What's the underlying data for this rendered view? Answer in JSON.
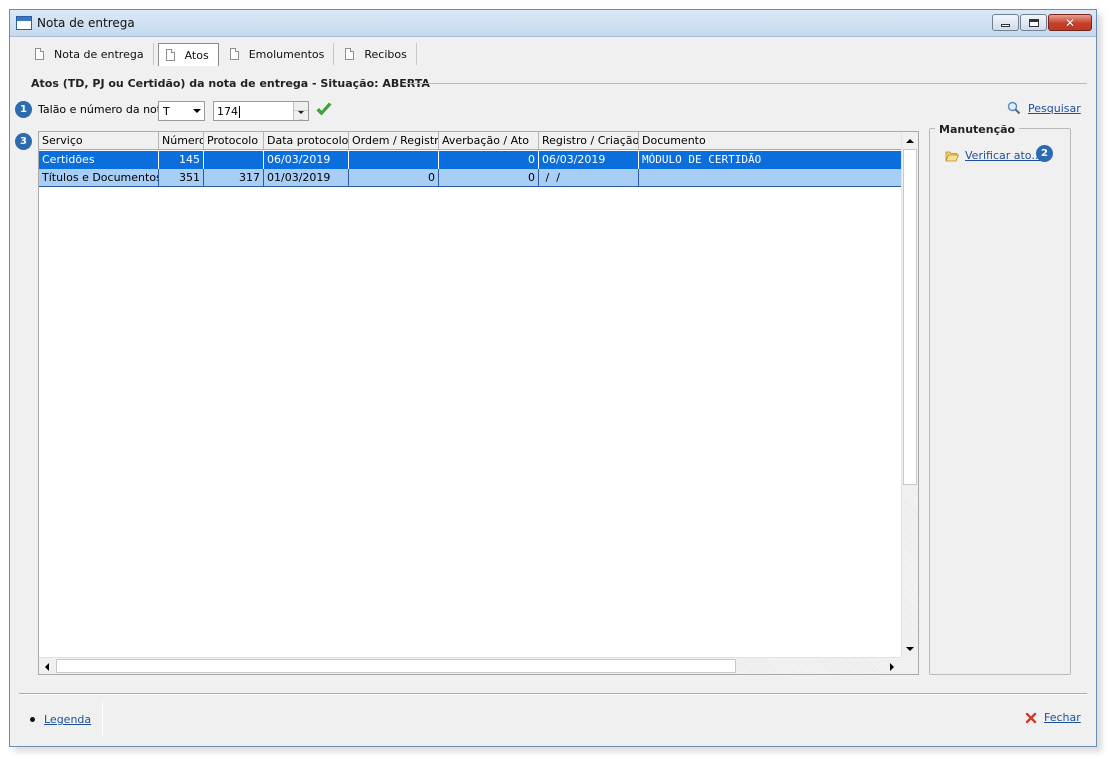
{
  "window": {
    "title": "Nota de entrega"
  },
  "tabs": [
    {
      "label": "Nota de entrega",
      "active": false
    },
    {
      "label": "Atos",
      "active": true
    },
    {
      "label": "Emolumentos",
      "active": false
    },
    {
      "label": "Recibos",
      "active": false
    }
  ],
  "section": {
    "title": "Atos (TD, PJ ou Certidão) da nota de entrega - Situação: ABERTA"
  },
  "badges": [
    "1",
    "2",
    "3"
  ],
  "filter": {
    "label": "Talão e número da nota:",
    "talao_value": "T",
    "numero_value": "174"
  },
  "search": {
    "label": "Pesquisar"
  },
  "table": {
    "columns": [
      "Serviço",
      "Número",
      "Protocolo",
      "Data protocolo",
      "Ordem / Registro",
      "Averbação / Ato",
      "Registro / Criação",
      "Documento"
    ],
    "rows": [
      {
        "servico": "Certidões",
        "numero": "145",
        "protocolo": "",
        "data_protocolo": "06/03/2019",
        "ordem_registro": "",
        "averbacao_ato": "0",
        "registro_criacao": "06/03/2019",
        "documento": "MÓDULO DE CERTIDÃO",
        "selected": true
      },
      {
        "servico": "Títulos e Documentos",
        "numero": "351",
        "protocolo": "317",
        "data_protocolo": "01/03/2019",
        "ordem_registro": "0",
        "averbacao_ato": "0",
        "registro_criacao": " /  / ",
        "documento": "",
        "selected": false
      }
    ]
  },
  "maintenance": {
    "title": "Manutenção",
    "verify_label": "Verificar ato..."
  },
  "footer": {
    "legend_label": "Legenda",
    "close_label": "Fechar"
  },
  "colors": {
    "selection": "#0a6fdc",
    "row_alt": "#a9cef6",
    "badge": "#2c6bb0",
    "link": "#1f4f9a",
    "accent_check": "#3cae3c"
  }
}
